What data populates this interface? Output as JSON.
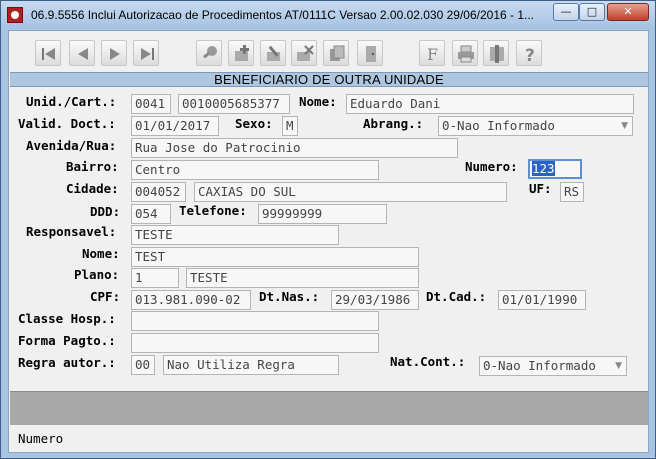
{
  "window": {
    "title": "06.9.5556   Inclui  Autorizacao de Procedimentos AT/0111C Versao 2.00.02.030 29/06/2016 - 1...",
    "minimize_label": "—",
    "maximize_label": "□",
    "close_label": "✕"
  },
  "toolbar": {
    "icons": [
      "first-record-icon",
      "previous-record-icon",
      "next-record-icon",
      "last-record-icon",
      "search-key-icon",
      "add-record-icon",
      "edit-record-icon",
      "delete-record-icon",
      "copy-record-icon",
      "exit-door-icon",
      "filter-icon",
      "print-icon",
      "utilities-icon",
      "help-icon"
    ]
  },
  "header": {
    "title": "BENEFICIARIO DE OUTRA UNIDADE"
  },
  "form": {
    "unid_cart_label": "Unid./Cart.:",
    "unid_value": "0041",
    "cart_value": "0010005685377",
    "nome_label": "Nome:",
    "nome_value": "Eduardo Dani",
    "valid_doct_label": "Valid. Doct.:",
    "valid_doct_value": "01/01/2017",
    "sexo_label": "Sexo:",
    "sexo_value": "M",
    "abrang_label": "Abrang.:",
    "abrang_value": "0-Nao Informado",
    "avenida_label": "Avenida/Rua:",
    "avenida_value": "Rua Jose do Patrocinio",
    "bairro_label": "Bairro:",
    "bairro_value": "Centro",
    "numero_label": "Numero:",
    "numero_value": "123",
    "cidade_label": "Cidade:",
    "cidade_code": "004052",
    "cidade_value": "CAXIAS DO SUL",
    "uf_label": "UF:",
    "uf_value": "RS",
    "ddd_label": "DDD:",
    "ddd_value": "054",
    "telefone_label": "Telefone:",
    "telefone_value": "99999999",
    "responsavel_label": "Responsavel:",
    "responsavel_value": "TESTE",
    "nome2_label": "Nome:",
    "nome2_value": "TEST",
    "plano_label": "Plano:",
    "plano_code": "1",
    "plano_value": "TESTE",
    "cpf_label": "CPF:",
    "cpf_value": "013.981.090-02",
    "dtnas_label": "Dt.Nas.:",
    "dtnas_value": "29/03/1986",
    "dtcad_label": "Dt.Cad.:",
    "dtcad_value": "01/01/1990",
    "classe_label": "Classe Hosp.:",
    "classe_value": "",
    "forma_label": "Forma Pagto.:",
    "forma_value": "",
    "regra_label": "Regra autor.:",
    "regra_code": "00",
    "regra_value": "Nao Utiliza Regra",
    "natcont_label": "Nat.Cont.:",
    "natcont_value": "0-Nao Informado"
  },
  "status": {
    "text": "Numero"
  }
}
